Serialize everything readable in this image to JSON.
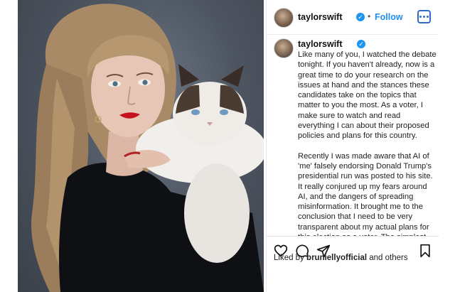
{
  "post": {
    "username": "taylorswift",
    "verified_glyph": "✓",
    "separator": "•",
    "follow_label": "Follow",
    "caption_paragraphs": [
      "Like many of you, I watched the debate tonight. If you haven't already, now is a great time to do your research on the issues at hand and the stances these candidates take on the topics that matter to you the most. As a voter, I make sure to watch and read everything I can about their proposed policies and plans for this country.",
      "Recently I was made aware that AI of 'me' falsely endorsing Donald Trump's presidential run was posted to his site. It really conjured up my fears around AI, and the dangers of spreading misinformation. It brought me to the conclusion that I need to be very transparent about my actual plans for this election as a voter. The simplest way to combat misinformation is with the truth."
    ],
    "likes": {
      "prefix": "Liked by",
      "user": "bruniellyofficial",
      "suffix": "and others"
    }
  },
  "icons": [
    "more-options-icon",
    "verified-badge-icon",
    "heart-icon",
    "comment-icon",
    "share-icon",
    "bookmark-icon"
  ],
  "colors": {
    "follow_blue": "#1f8ef1",
    "verified_blue": "#1d95f0",
    "options_border": "#2d6bc9"
  }
}
